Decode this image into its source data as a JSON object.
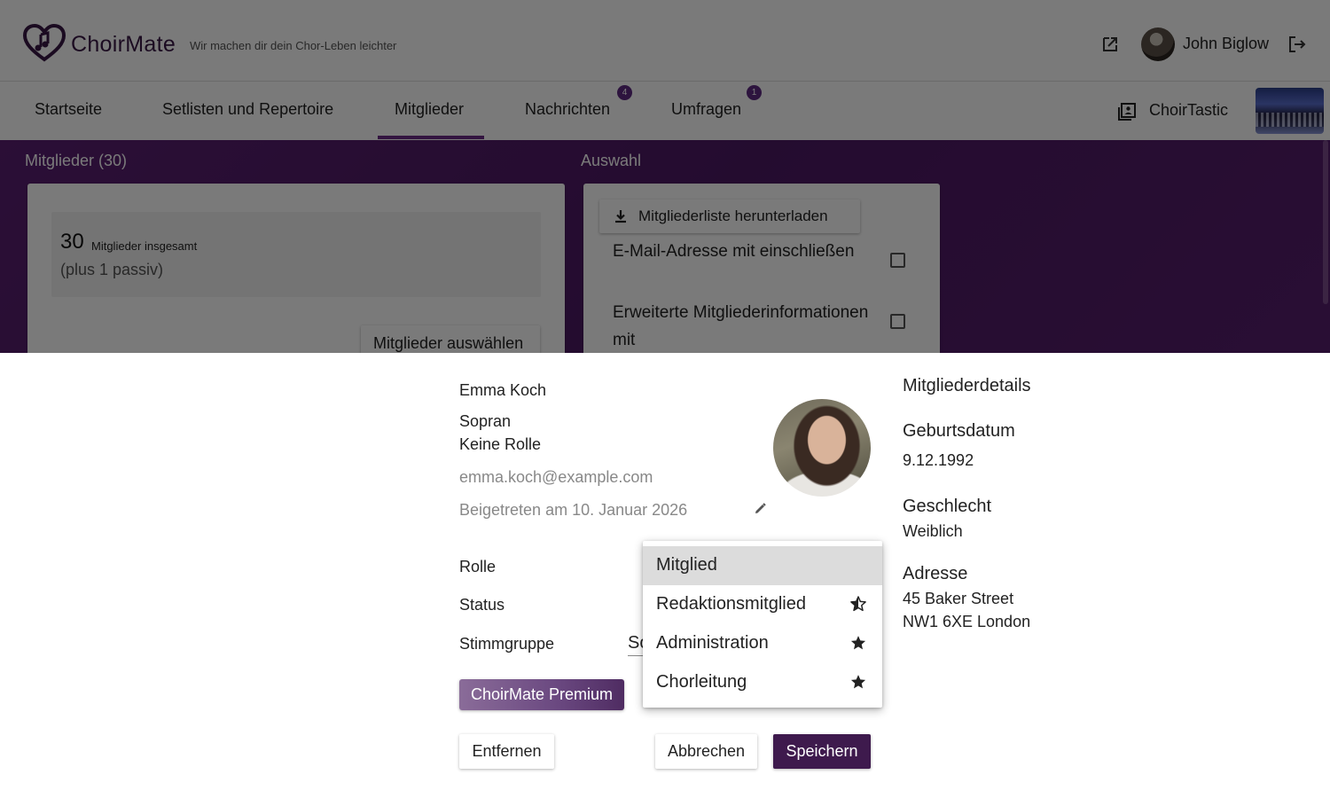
{
  "header": {
    "brand": "ChoirMate",
    "tagline": "Wir machen dir dein Chor-Leben leichter",
    "user_name": "John Biglow"
  },
  "nav": {
    "items": [
      {
        "label": "Startseite"
      },
      {
        "label": "Setlisten und Repertoire"
      },
      {
        "label": "Mitglieder",
        "active": true
      },
      {
        "label": "Nachrichten",
        "badge": "4"
      },
      {
        "label": "Umfragen",
        "badge": "1"
      }
    ],
    "choir_name": "ChoirTastic"
  },
  "members_panel": {
    "title": "Mitglieder (30)",
    "total_count": "30",
    "total_label": "Mitglieder insgesamt",
    "passive_note": "(plus 1 passiv)",
    "select_button": "Mitglieder auswählen"
  },
  "selection_panel": {
    "title": "Auswahl",
    "download_button": "Mitgliederliste herunterladen",
    "options": [
      {
        "label": "E-Mail-Adresse mit einschließen",
        "checked": false
      },
      {
        "label": "Erweiterte Mitgliederinformationen mit",
        "checked": false
      }
    ]
  },
  "dialog": {
    "name": "Emma Koch",
    "voice": "Sopran",
    "role_text": "Keine Rolle",
    "email": "emma.koch@example.com",
    "joined": "Beigetreten am 10. Januar 2026",
    "fields": {
      "role_label": "Rolle",
      "status_label": "Status",
      "voice_group_label": "Stimmgruppe",
      "voice_group_value": "Sopran"
    },
    "premium_button": "ChoirMate Premium",
    "remove_button": "Entfernen",
    "cancel_button": "Abbrechen",
    "save_button": "Speichern",
    "role_menu": [
      {
        "label": "Mitglied",
        "selected": true,
        "icon": ""
      },
      {
        "label": "Redaktionsmitglied",
        "selected": false,
        "icon": "star-half-icon"
      },
      {
        "label": "Administration",
        "selected": false,
        "icon": "star-icon"
      },
      {
        "label": "Chorleitung",
        "selected": false,
        "icon": "star-icon"
      }
    ],
    "details": {
      "title": "Mitgliederdetails",
      "birthdate_label": "Geburtsdatum",
      "birthdate": "9.12.1992",
      "gender_label": "Geschlecht",
      "gender": "Weiblich",
      "address_label": "Adresse",
      "address_line1": "45 Baker Street",
      "address_line2": "NW1 6XE London"
    }
  },
  "colors": {
    "brand_purple": "#5a1f72",
    "primary_button": "#3e1a4d",
    "badge": "#5e2a82"
  }
}
